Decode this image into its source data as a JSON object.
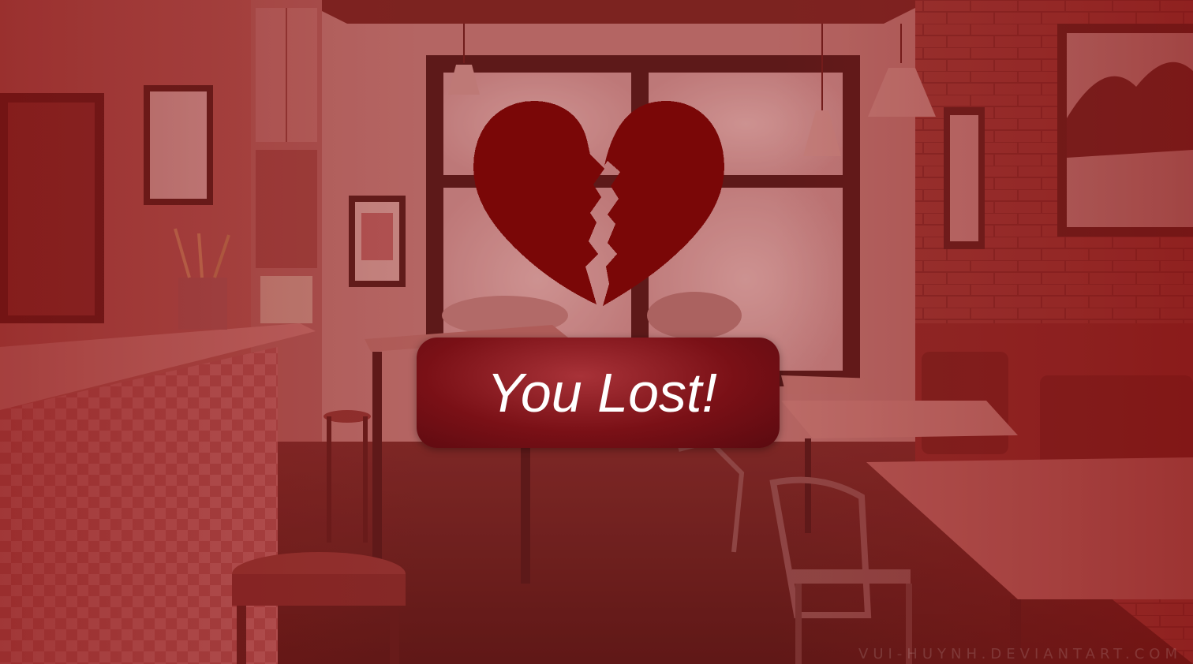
{
  "result": {
    "message": "You Lost!"
  },
  "background": {
    "watermark": "VUI-HUYNH.DEVIANTART.COM",
    "tint_color": "#8a1a1a"
  },
  "icons": {
    "status_icon": "broken-heart-icon",
    "heart_color": "#7a0a0a"
  }
}
